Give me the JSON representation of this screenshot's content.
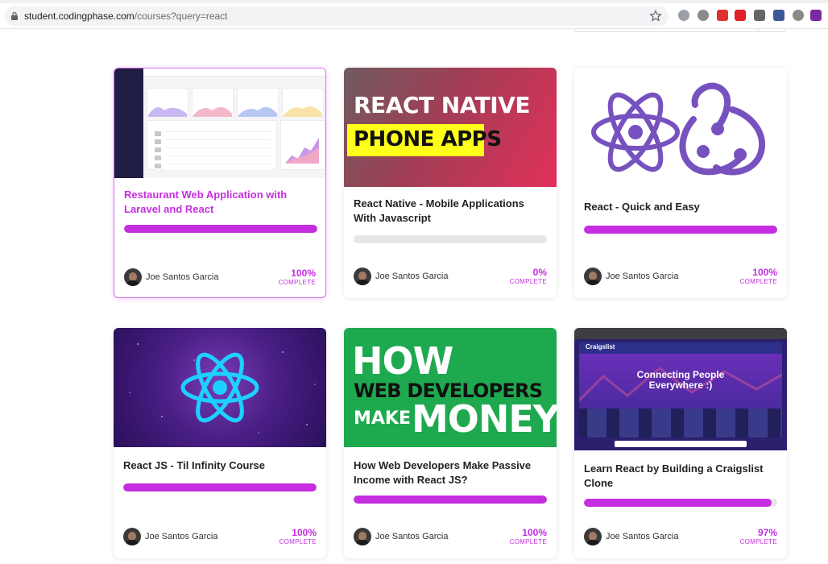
{
  "browser": {
    "url_host": "student.codingphase.com",
    "url_path": "/courses?query=react",
    "extensions": [
      {
        "name": "abp-icon",
        "color": "#9aa0a6"
      },
      {
        "name": "robot-icon",
        "color": "#8a8a8a"
      },
      {
        "name": "red-app-icon",
        "color": "#e03030"
      },
      {
        "name": "youtube-icon",
        "color": "#e0202a"
      },
      {
        "name": "eyedropper-icon",
        "color": "#666666"
      },
      {
        "name": "facebook-icon",
        "color": "#3b5998"
      },
      {
        "name": "camera-icon",
        "color": "#8a8a8a"
      },
      {
        "name": "purple-app-icon",
        "color": "#7a2aa0"
      }
    ]
  },
  "colors": {
    "accent": "#c42ee0",
    "track": "#e6e6e6"
  },
  "courses": [
    {
      "title": "Restaurant Web Application with Laravel and React",
      "author": "Joe Santos Garcia",
      "percent": "100%",
      "progress": 1.0,
      "complete_label": "COMPLETE",
      "thumbnail": "dashboard-screenshot"
    },
    {
      "title": "React Native - Mobile Applications With Javascript",
      "author": "Joe Santos Garcia",
      "percent": "0%",
      "progress": 0.0,
      "complete_label": "COMPLETE",
      "thumbnail": "react-native-phone-apps",
      "thumb_text_1": "REACT NATIVE",
      "thumb_text_2": "PHONE APPS"
    },
    {
      "title": "React - Quick and Easy",
      "author": "Joe Santos Garcia",
      "percent": "100%",
      "progress": 1.0,
      "complete_label": "COMPLETE",
      "thumbnail": "react-and-redux-logos"
    },
    {
      "title": "React JS - Til Infinity Course",
      "author": "Joe Santos Garcia",
      "percent": "100%",
      "progress": 1.0,
      "complete_label": "COMPLETE",
      "thumbnail": "react-logo-space"
    },
    {
      "title": "How Web Developers Make Passive Income with React JS?",
      "author": "Joe Santos Garcia",
      "percent": "100%",
      "progress": 1.0,
      "complete_label": "COMPLETE",
      "thumbnail": "how-web-developers-make-money",
      "thumb_text_1": "HOW",
      "thumb_text_2": "WEB DEVELOPERS",
      "thumb_text_3": "MAKE",
      "thumb_text_4": "MONEY"
    },
    {
      "title": "Learn React by Building a Craigslist Clone",
      "author": "Joe Santos Garcia",
      "percent": "97%",
      "progress": 0.97,
      "complete_label": "COMPLETE",
      "thumbnail": "craigslist-clone-screenshot",
      "thumb_text_1": "Connecting People Everywhere :)",
      "thumb_text_2": "Craigslist"
    }
  ]
}
